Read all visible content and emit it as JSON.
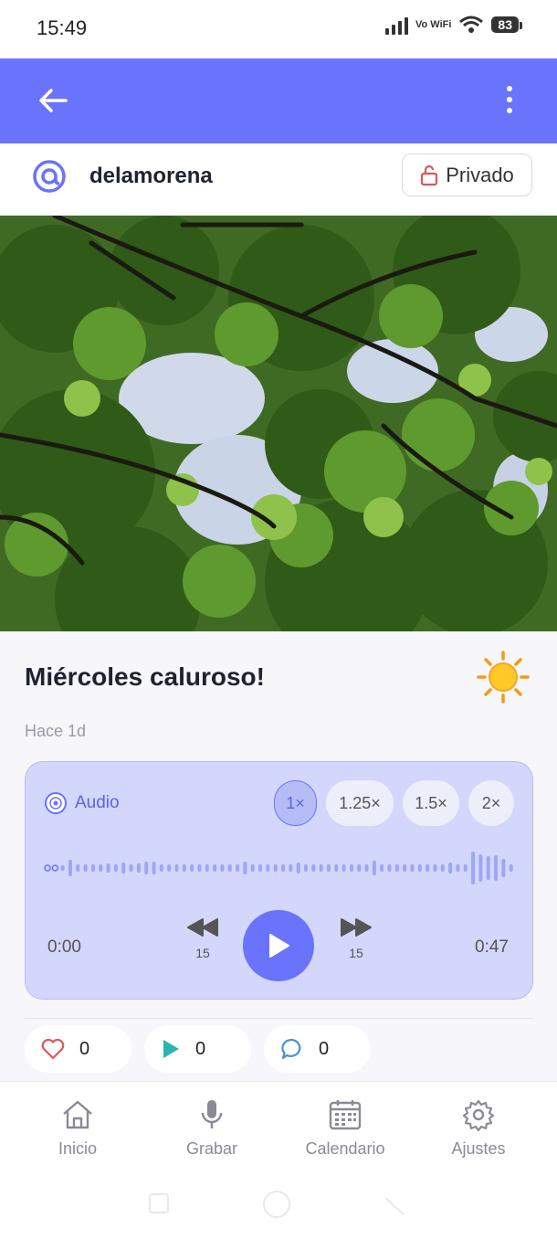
{
  "status_bar": {
    "time": "15:49",
    "network": "Vo WiFi",
    "battery": "83"
  },
  "app_bar": {
    "back_icon": "arrow-left-icon",
    "menu_icon": "more-vertical-icon"
  },
  "post_header": {
    "username": "delamorena",
    "privacy_label": "Privado"
  },
  "post": {
    "title": "Miércoles caluroso!",
    "time_ago": "Hace 1d",
    "mood_icon": "sun-icon"
  },
  "audio_player": {
    "label": "Audio",
    "speeds": [
      "1×",
      "1.25×",
      "1.5×",
      "2×"
    ],
    "selected_speed": "1×",
    "current_time": "0:00",
    "duration": "0:47",
    "rewind_seconds": "15",
    "forward_seconds": "15",
    "progress": 0
  },
  "stats": {
    "likes": "0",
    "plays": "0",
    "comments": "0"
  },
  "bottom_nav": {
    "items": [
      {
        "label": "Inicio",
        "icon": "home-icon"
      },
      {
        "label": "Grabar",
        "icon": "microphone-icon"
      },
      {
        "label": "Calendario",
        "icon": "calendar-icon"
      },
      {
        "label": "Ajustes",
        "icon": "gear-icon"
      }
    ]
  },
  "colors": {
    "accent": "#6a73fb",
    "card": "#d2d7fb",
    "like": "#e0565b",
    "play": "#2bb5b0",
    "comment": "#4a90d9"
  }
}
